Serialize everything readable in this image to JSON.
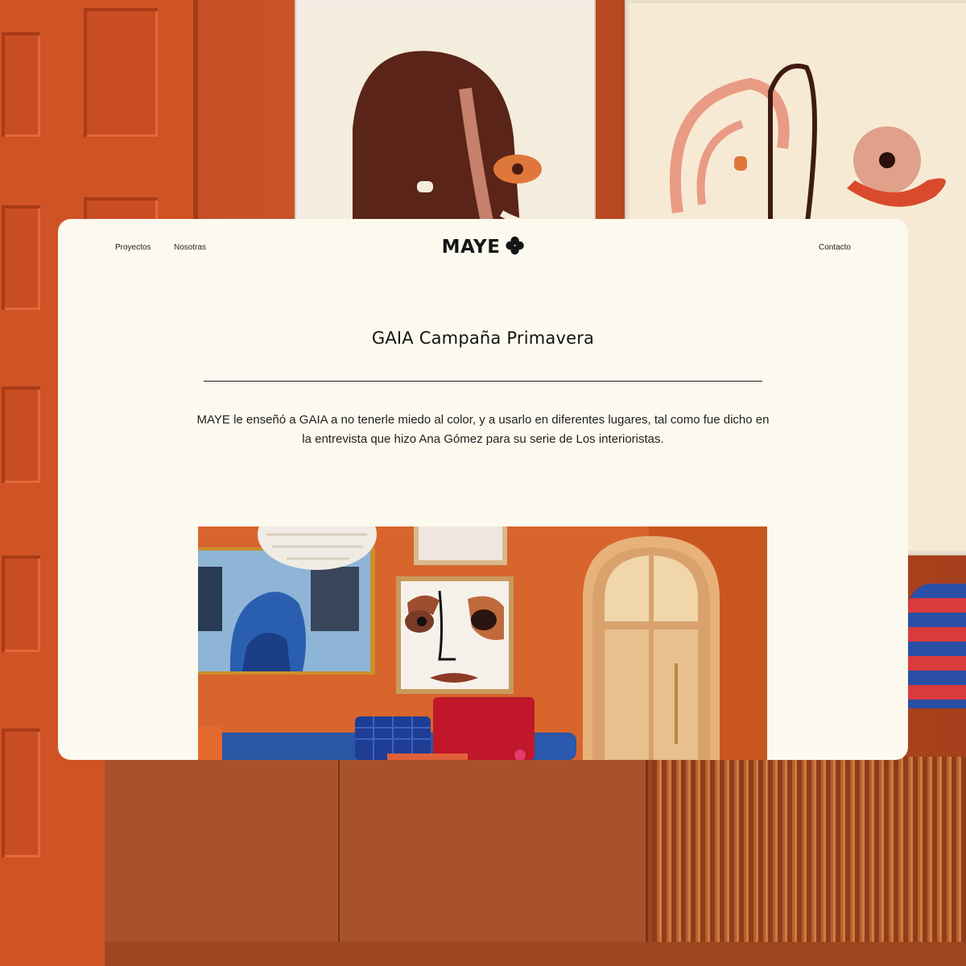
{
  "nav": {
    "links": [
      {
        "label": "Proyectos"
      },
      {
        "label": "Nosotras"
      }
    ],
    "contact_label": "Contacto",
    "logo_text": "MAYE",
    "logo_icon": "flower-icon"
  },
  "page": {
    "title": "GAIA Campaña Primavera",
    "intro": "MAYE le enseñó a GAIA a no tenerle miedo al color, y a usarlo en diferentes lugares, tal como fue dicho en la entrevista que hizo Ana Gómez para su serie de Los interioristas."
  },
  "colors": {
    "card_bg": "#fcf9ee",
    "text": "#1f1f1f",
    "wall_orange": "#c9552a"
  }
}
